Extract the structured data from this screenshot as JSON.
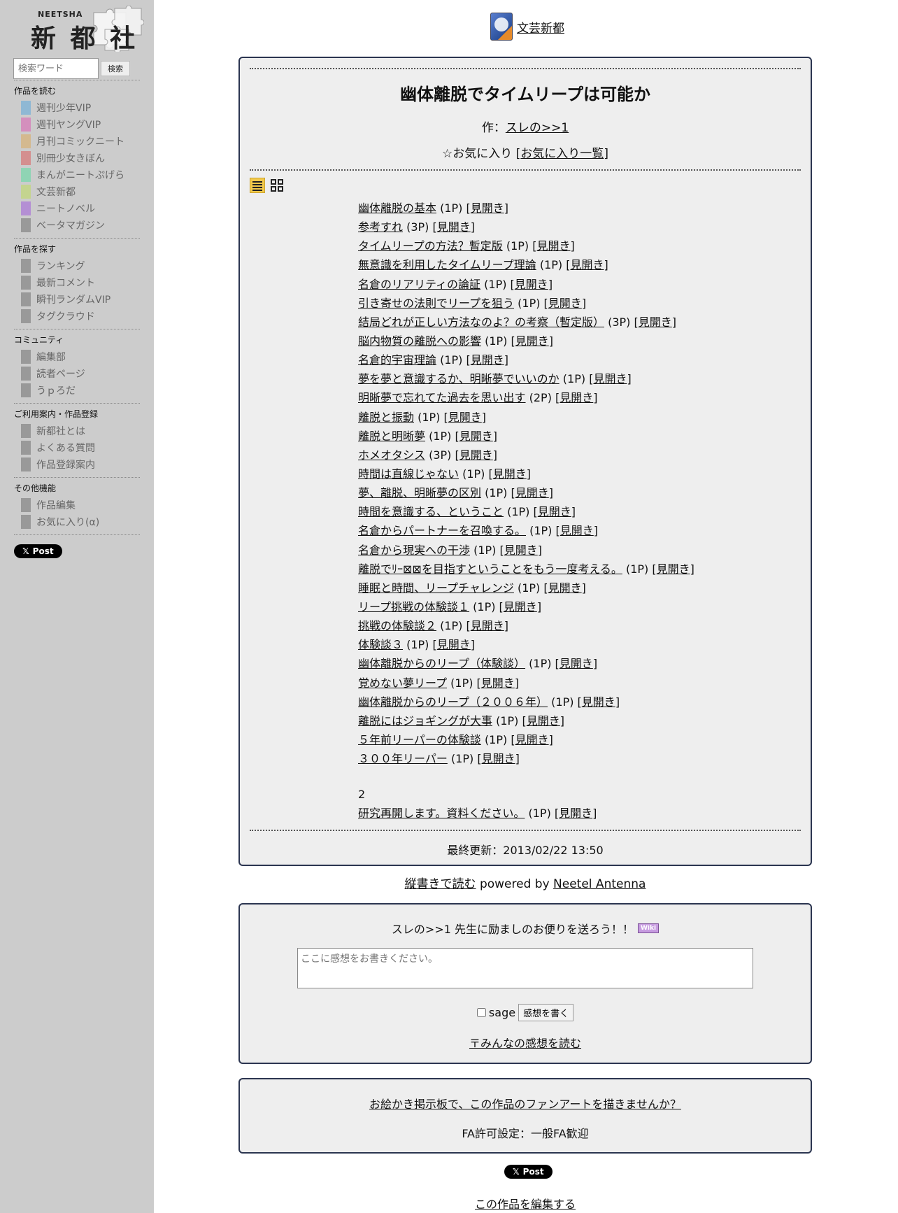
{
  "sidebar": {
    "logo_small": "NEETSHA",
    "logo_main": "新 都 社",
    "search_placeholder": "検索ワード",
    "search_button": "検索",
    "sections": [
      {
        "title": "作品を読む",
        "items": [
          {
            "label": "週刊少年VIP",
            "color": "#8fb8d4"
          },
          {
            "label": "週刊ヤングVIP",
            "color": "#d48fbd"
          },
          {
            "label": "月刊コミックニート",
            "color": "#d4b98f"
          },
          {
            "label": "別冊少女きぼん",
            "color": "#d48f8f"
          },
          {
            "label": "まんがニートぷげら",
            "color": "#8fd4b4"
          },
          {
            "label": "文芸新都",
            "color": "#c4d48f"
          },
          {
            "label": "ニートノベル",
            "color": "#b48fd4"
          },
          {
            "label": "ベータマガジン",
            "color": "#999999"
          }
        ]
      },
      {
        "title": "作品を探す",
        "items": [
          {
            "label": "ランキング",
            "color": "#999999"
          },
          {
            "label": "最新コメント",
            "color": "#999999"
          },
          {
            "label": "瞬刊ランダムVIP",
            "color": "#999999"
          },
          {
            "label": "タグクラウド",
            "color": "#999999"
          }
        ]
      },
      {
        "title": "コミュニティ",
        "items": [
          {
            "label": "編集部",
            "color": "#999999"
          },
          {
            "label": "読者ページ",
            "color": "#999999"
          },
          {
            "label": "うｐろだ",
            "color": "#999999"
          }
        ]
      },
      {
        "title": "ご利用案内・作品登録",
        "items": [
          {
            "label": "新都社とは",
            "color": "#999999"
          },
          {
            "label": "よくある質問",
            "color": "#999999"
          },
          {
            "label": "作品登録案内",
            "color": "#999999"
          }
        ]
      },
      {
        "title": "その他機能",
        "items": [
          {
            "label": "作品編集",
            "color": "#999999"
          },
          {
            "label": "お気に入り(α)",
            "color": "#999999"
          }
        ]
      }
    ],
    "tweet_label": "Post"
  },
  "topnav": {
    "label": "文芸新都"
  },
  "work": {
    "title": "幽体離脱でタイムリープは可能か",
    "author_prefix": "作：",
    "author": "スレの>>1",
    "fav_prefix": "☆お気に入り [",
    "fav_link": "お気に入り一覧",
    "fav_suffix": "]",
    "chapters": [
      {
        "title": "幽体離脱の基本",
        "pages": "(1P)",
        "spread": "見開き"
      },
      {
        "title": "参考すれ",
        "pages": "(3P)",
        "spread": "見開き"
      },
      {
        "title": "タイムリープの方法？暫定版",
        "pages": "(1P)",
        "spread": "見開き"
      },
      {
        "title": "無意識を利用したタイムリープ理論",
        "pages": "(1P)",
        "spread": "見開き"
      },
      {
        "title": "名倉のリアリティの論証",
        "pages": "(1P)",
        "spread": "見開き"
      },
      {
        "title": "引き寄せの法則でリープを狙う",
        "pages": "(1P)",
        "spread": "見開き"
      },
      {
        "title": "結局どれが正しい方法なのよ？の考察（暫定版）",
        "pages": "(3P)",
        "spread": "見開き"
      },
      {
        "title": "脳内物質の離脱への影響",
        "pages": "(1P)",
        "spread": "見開き"
      },
      {
        "title": "名倉的宇宙理論",
        "pages": "(1P)",
        "spread": "見開き"
      },
      {
        "title": "夢を夢と意識するか、明晰夢でいいのか",
        "pages": "(1P)",
        "spread": "見開き"
      },
      {
        "title": "明晰夢で忘れてた過去を思い出す",
        "pages": "(2P)",
        "spread": "見開き"
      },
      {
        "title": "離脱と振動",
        "pages": "(1P)",
        "spread": "見開き"
      },
      {
        "title": "離脱と明晰夢",
        "pages": "(1P)",
        "spread": "見開き"
      },
      {
        "title": "ホメオタシス",
        "pages": "(3P)",
        "spread": "見開き"
      },
      {
        "title": "時間は直線じゃない",
        "pages": "(1P)",
        "spread": "見開き"
      },
      {
        "title": "夢、離脱、明晰夢の区別",
        "pages": "(1P)",
        "spread": "見開き"
      },
      {
        "title": "時間を意識する、ということ",
        "pages": "(1P)",
        "spread": "見開き"
      },
      {
        "title": "名倉からパートナーを召喚する。",
        "pages": "(1P)",
        "spread": "見開き"
      },
      {
        "title": "名倉から現実への干渉",
        "pages": "(1P)",
        "spread": "見開き"
      },
      {
        "title": "離脱でﾘｰ⊠⊠を目指すということをもう一度考える。",
        "pages": "(1P)",
        "spread": "見開き"
      },
      {
        "title": "睡眠と時間、リープチャレンジ",
        "pages": "(1P)",
        "spread": "見開き"
      },
      {
        "title": "リープ挑戦の体験談１",
        "pages": "(1P)",
        "spread": "見開き"
      },
      {
        "title": "挑戦の体験談２",
        "pages": "(1P)",
        "spread": "見開き"
      },
      {
        "title": "体験談３",
        "pages": "(1P)",
        "spread": "見開き"
      },
      {
        "title": "幽体離脱からのリープ（体験談）",
        "pages": "(1P)",
        "spread": "見開き"
      },
      {
        "title": "覚めない夢リープ",
        "pages": "(1P)",
        "spread": "見開き"
      },
      {
        "title": "幽体離脱からのリープ（２００６年）",
        "pages": "(1P)",
        "spread": "見開き"
      },
      {
        "title": "離脱にはジョギングが大事",
        "pages": "(1P)",
        "spread": "見開き"
      },
      {
        "title": "５年前リーパーの体験談",
        "pages": "(1P)",
        "spread": "見開き"
      },
      {
        "title": "３００年リーパー",
        "pages": "(1P)",
        "spread": "見開き"
      }
    ],
    "group2_label": "2",
    "chapters2": [
      {
        "title": "研究再開します。資料ください。",
        "pages": "(1P)",
        "spread": "見開き"
      }
    ],
    "updated": "最終更新：2013/02/22 13:50"
  },
  "under_box": {
    "vertical_link": "縦書きで読む",
    "powered_by": "powered by",
    "powered_link": "Neetel Antenna"
  },
  "comment": {
    "message": "スレの>>1 先生に励ましのお便りを送ろう！！",
    "wiki_badge": "Wiki",
    "textarea_placeholder": "ここに感想をお書きください。",
    "sage_label": "sage",
    "write_button": "感想を書く",
    "read_link": "みんなの感想を読む",
    "read_link_prefix": "〒"
  },
  "fanart": {
    "link": "お絵かき掲示板で、この作品のファンアートを描きませんか？",
    "setting": "FA許可設定：一般FA歓迎"
  },
  "footer": {
    "tweet_label": "Post",
    "edit_link": "この作品を編集する"
  }
}
